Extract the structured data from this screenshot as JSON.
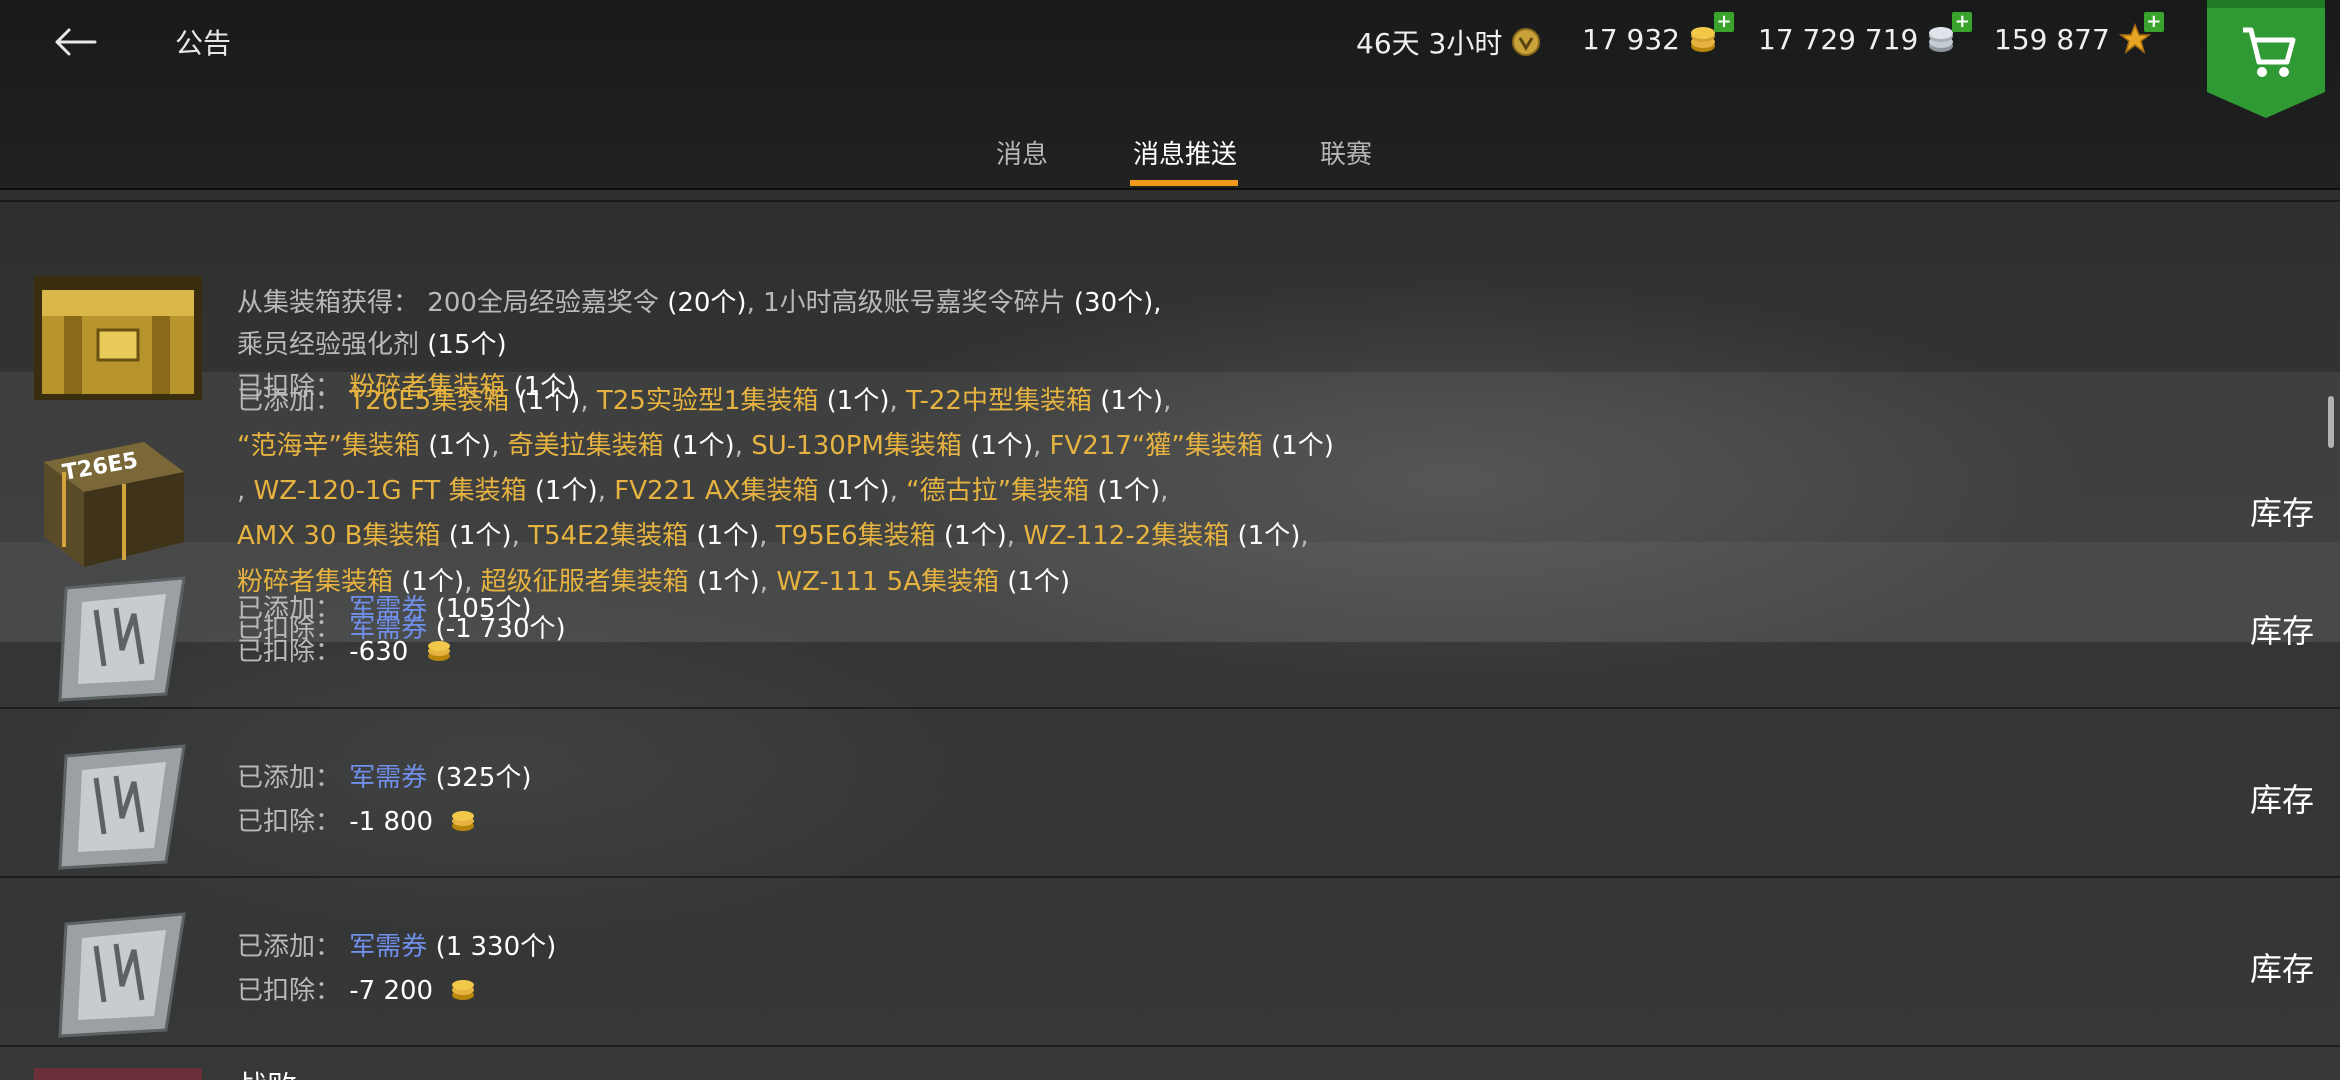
{
  "header": {
    "title": "公告",
    "premium_time": "46天 3小时",
    "gold": "17 932",
    "credits": "17 729 719",
    "free_xp": "159 877",
    "plus_symbol": "+"
  },
  "tabs": [
    {
      "label": "消息",
      "active": false
    },
    {
      "label": "消息推送",
      "active": true
    },
    {
      "label": "联赛",
      "active": false
    }
  ],
  "colors": {
    "accent": "#f09a1c",
    "item_gold": "#e6b341",
    "item_blue": "#6f8fea",
    "add_green": "#3aa32c"
  },
  "messages": [
    {
      "icon": "golden-container-icon",
      "line1_label": "从集装箱获得：",
      "line1_item1": "200全局经验嘉奖令",
      "line1_item1_qty": "(20个)",
      "sep": ",",
      "line1_item2": "1小时高级账号嘉奖令碎片",
      "line1_item2_qty": "(30个)",
      "line2_item": "乘员经验强化剂",
      "line2_qty": "(15个)"
    },
    {
      "icon": "t26e5-container-icon",
      "container_label": "T26E5",
      "removed_label": "已扣除：",
      "removed_item": "粉碎者集装箱",
      "removed_qty": "(1个)",
      "added_label": "已添加：",
      "items": [
        {
          "name": "T26E5集装箱",
          "qty": "(1个)"
        },
        {
          "name": "T25实验型1集装箱",
          "qty": "(1个)"
        },
        {
          "name": "T-22中型集装箱",
          "qty": "(1个)"
        },
        {
          "name": "“范海辛”集装箱",
          "qty": "(1个)"
        },
        {
          "name": "奇美拉集装箱",
          "qty": "(1个)"
        },
        {
          "name": "SU-130PM集装箱",
          "qty": "(1个)"
        },
        {
          "name": "FV217“獾”集装箱",
          "qty": "(1个)"
        },
        {
          "name": "WZ-120-1G FT 集装箱",
          "qty": "(1个)"
        },
        {
          "name": "FV221 AX集装箱",
          "qty": "(1个)"
        },
        {
          "name": "“德古拉”集装箱",
          "qty": "(1个)"
        },
        {
          "name": "AMX 30 B集装箱",
          "qty": "(1个)"
        },
        {
          "name": "T54E2集装箱",
          "qty": "(1个)"
        },
        {
          "name": "T95E6集装箱",
          "qty": "(1个)"
        },
        {
          "name": "WZ-112-2集装箱",
          "qty": "(1个)"
        },
        {
          "name": "粉碎者集装箱",
          "qty": "(1个)"
        },
        {
          "name": "超级征服者集装箱",
          "qty": "(1个)"
        },
        {
          "name": "WZ-111 5A集装箱",
          "qty": "(1个)"
        }
      ],
      "inventory": "库存"
    },
    {
      "icon": "ticket-icon",
      "added_label": "已添加：",
      "added_item": "军需券",
      "added_qty": "(105个)",
      "overlap_removed_label": "已扣除：",
      "overlap_removed_item": "军需券",
      "overlap_removed_qty": "(-1 730个)",
      "removed_label": "已扣除：",
      "removed_value": "-630",
      "inventory": "库存"
    },
    {
      "icon": "ticket-icon",
      "added_label": "已添加：",
      "added_item": "军需券",
      "added_qty": "(325个)",
      "removed_label": "已扣除：",
      "removed_value": "-1 800",
      "inventory": "库存"
    },
    {
      "icon": "ticket-icon",
      "added_label": "已添加：",
      "added_item": "军需券",
      "added_qty": "(1 330个)",
      "removed_label": "已扣除：",
      "removed_value": "-7 200",
      "inventory": "库存"
    }
  ],
  "bottom_peek_text": "战败"
}
